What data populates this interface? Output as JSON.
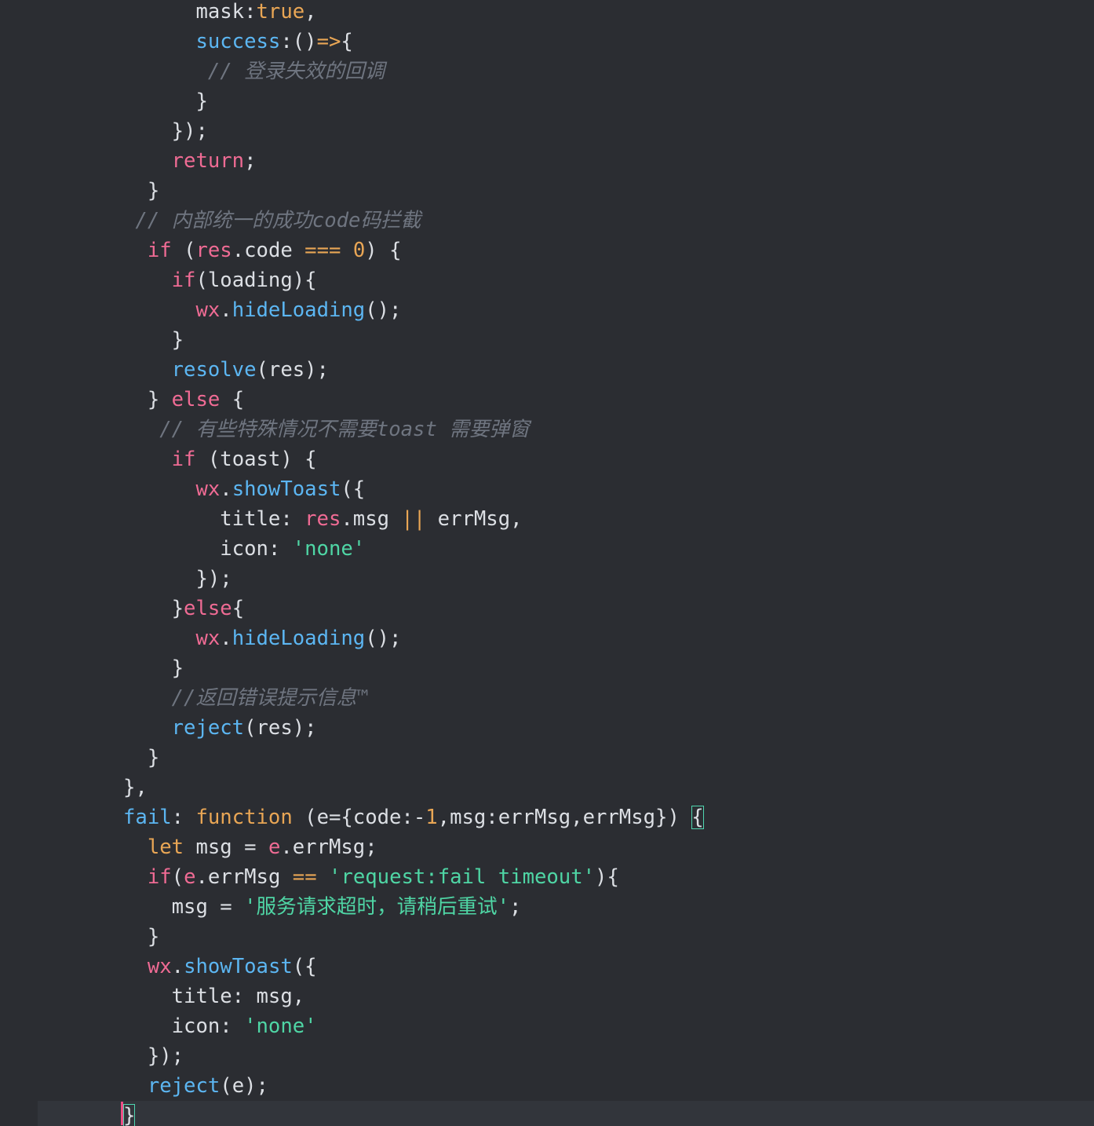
{
  "editor": {
    "colors": {
      "background": "#2b2d32",
      "current_line": "#32353b",
      "plain": "#dcdfe4",
      "keyword": "#ef6b94",
      "func": "#5cb6f2",
      "accent": "#e9a655",
      "string": "#4fd6a5",
      "comment": "#6f7580",
      "cursor": "#ee4e86",
      "bracket_match": "#4fd6b0"
    },
    "lines": [
      [
        {
          "plain": "      mask:"
        },
        {
          "accent": "true"
        },
        {
          "plain": ","
        }
      ],
      [
        {
          "plain": "      "
        },
        {
          "func": "success"
        },
        {
          "plain": ":()"
        },
        {
          "accent": "=>"
        },
        {
          "plain": "{"
        }
      ],
      [
        {
          "plain": "       "
        },
        {
          "comment": "// 登录失效的回调"
        }
      ],
      [
        {
          "plain": "      }"
        }
      ],
      [
        {
          "plain": "    });"
        }
      ],
      [
        {
          "plain": "    "
        },
        {
          "keyword": "return"
        },
        {
          "plain": ";"
        }
      ],
      [
        {
          "plain": "  }"
        }
      ],
      [
        {
          "plain": " "
        },
        {
          "comment": "// 内部统一的成功code码拦截"
        }
      ],
      [
        {
          "plain": "  "
        },
        {
          "keyword": "if"
        },
        {
          "plain": " ("
        },
        {
          "keyword": "res"
        },
        {
          "plain": ".code "
        },
        {
          "accent": "==="
        },
        {
          "plain": " "
        },
        {
          "accent": "0"
        },
        {
          "plain": ") {"
        }
      ],
      [
        {
          "plain": "    "
        },
        {
          "keyword": "if"
        },
        {
          "plain": "(loading){"
        }
      ],
      [
        {
          "plain": "      "
        },
        {
          "keyword": "wx"
        },
        {
          "plain": "."
        },
        {
          "func": "hideLoading"
        },
        {
          "plain": "();"
        }
      ],
      [
        {
          "plain": "    }"
        }
      ],
      [
        {
          "plain": "    "
        },
        {
          "func": "resolve"
        },
        {
          "plain": "(res);"
        }
      ],
      [
        {
          "plain": "  } "
        },
        {
          "keyword": "else"
        },
        {
          "plain": " {"
        }
      ],
      [
        {
          "plain": "   "
        },
        {
          "comment": "// 有些特殊情况不需要toast 需要弹窗"
        }
      ],
      [
        {
          "plain": "    "
        },
        {
          "keyword": "if"
        },
        {
          "plain": " (toast) {"
        }
      ],
      [
        {
          "plain": "      "
        },
        {
          "keyword": "wx"
        },
        {
          "plain": "."
        },
        {
          "func": "showToast"
        },
        {
          "plain": "({"
        }
      ],
      [
        {
          "plain": "        title: "
        },
        {
          "keyword": "res"
        },
        {
          "plain": ".msg "
        },
        {
          "accent": "||"
        },
        {
          "plain": " errMsg,"
        }
      ],
      [
        {
          "plain": "        icon: "
        },
        {
          "string": "'none'"
        }
      ],
      [
        {
          "plain": "      });"
        }
      ],
      [
        {
          "plain": "    }"
        },
        {
          "keyword": "else"
        },
        {
          "plain": "{"
        }
      ],
      [
        {
          "plain": "      "
        },
        {
          "keyword": "wx"
        },
        {
          "plain": "."
        },
        {
          "func": "hideLoading"
        },
        {
          "plain": "();"
        }
      ],
      [
        {
          "plain": "    }"
        }
      ],
      [
        {
          "plain": "    "
        },
        {
          "comment": "//返回错误提示信息™"
        }
      ],
      [
        {
          "plain": "    "
        },
        {
          "func": "reject"
        },
        {
          "plain": "(res);"
        }
      ],
      [
        {
          "plain": "  }"
        }
      ],
      [
        {
          "plain": "},"
        }
      ],
      [
        {
          "func": "fail"
        },
        {
          "plain": ": "
        },
        {
          "accent": "function"
        },
        {
          "plain": " (e={code:-"
        },
        {
          "accent": "1"
        },
        {
          "plain": ",msg:errMsg,errMsg}) "
        },
        {
          "match": "{"
        }
      ],
      [
        {
          "plain": "  "
        },
        {
          "accent": "let"
        },
        {
          "plain": " msg = "
        },
        {
          "keyword": "e"
        },
        {
          "plain": ".errMsg;"
        }
      ],
      [
        {
          "plain": "  "
        },
        {
          "keyword": "if"
        },
        {
          "plain": "("
        },
        {
          "keyword": "e"
        },
        {
          "plain": ".errMsg "
        },
        {
          "accent": "=="
        },
        {
          "plain": " "
        },
        {
          "string": "'request:fail timeout'"
        },
        {
          "plain": "){"
        }
      ],
      [
        {
          "plain": "    msg = "
        },
        {
          "string": "'服务请求超时，请稍后重试'"
        },
        {
          "plain": ";"
        }
      ],
      [
        {
          "plain": "  }"
        }
      ],
      [
        {
          "plain": "  "
        },
        {
          "keyword": "wx"
        },
        {
          "plain": "."
        },
        {
          "func": "showToast"
        },
        {
          "plain": "({"
        }
      ],
      [
        {
          "plain": "    title: msg,"
        }
      ],
      [
        {
          "plain": "    icon: "
        },
        {
          "string": "'none'"
        }
      ],
      [
        {
          "plain": "  });"
        }
      ],
      [
        {
          "plain": "  "
        },
        {
          "func": "reject"
        },
        {
          "plain": "(e);"
        }
      ],
      [
        {
          "match": "}"
        }
      ]
    ]
  }
}
